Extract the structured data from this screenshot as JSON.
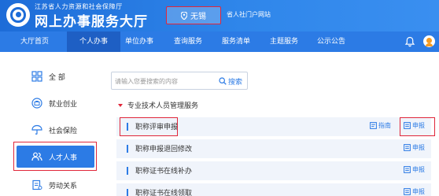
{
  "header": {
    "org_name": "江苏省人力资源和社会保障厅",
    "system_name": "网上办事服务大厅",
    "city": "无锡",
    "portal_link": "省人社门户网站"
  },
  "nav": {
    "items": [
      {
        "label": "大厅首页"
      },
      {
        "label": "个人办事"
      },
      {
        "label": "单位办事"
      },
      {
        "label": "查询服务"
      },
      {
        "label": "服务清单"
      },
      {
        "label": "主题服务"
      },
      {
        "label": "公示公告"
      }
    ],
    "active_index": 1
  },
  "sidebar": {
    "items": [
      {
        "label": "全 部",
        "icon": "grid-icon"
      },
      {
        "label": "就业创业",
        "icon": "briefcase-circle-icon"
      },
      {
        "label": "社会保险",
        "icon": "umbrella-icon"
      },
      {
        "label": "人才人事",
        "icon": "people-icon"
      },
      {
        "label": "劳动关系",
        "icon": "document-icon"
      }
    ],
    "active_index": 3
  },
  "search": {
    "placeholder": "请输入您要搜索的内容",
    "button_label": "搜索"
  },
  "category": {
    "title": "专业技术人员管理服务"
  },
  "services": [
    {
      "name": "职称评审申报",
      "guide": "指南",
      "apply": "申报"
    },
    {
      "name": "职称申报退回修改",
      "apply": "申报"
    },
    {
      "name": "职称证书在线补办",
      "apply": "申报"
    },
    {
      "name": "职称证书在线领取",
      "apply": "申报"
    }
  ],
  "colors": {
    "primary": "#2c7be5",
    "nav_active": "#1e5fc4",
    "highlight": "#e0263a",
    "row_bg": "#f0f4fb"
  }
}
